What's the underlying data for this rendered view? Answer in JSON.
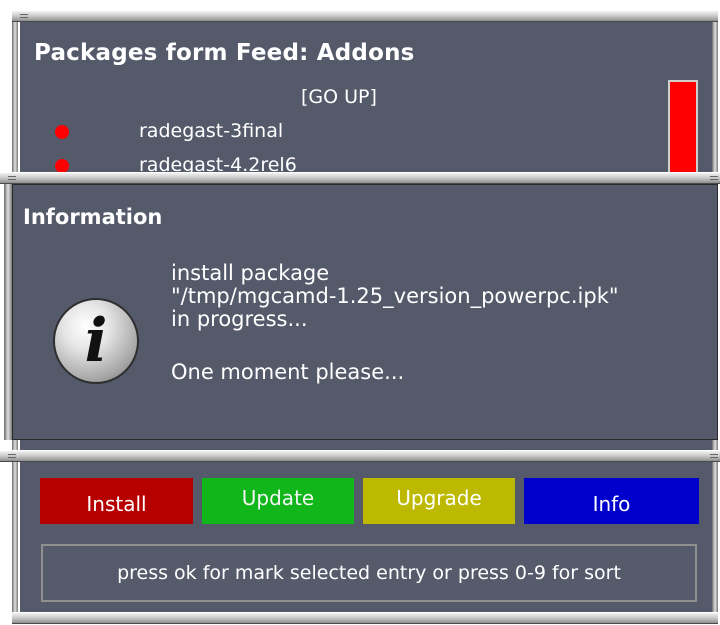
{
  "list_window": {
    "title": "Packages form Feed: Addons",
    "go_up": "[GO UP]",
    "items": [
      {
        "label": "radegast-3final"
      },
      {
        "label": "radegast-4.2rel6"
      }
    ]
  },
  "info_dialog": {
    "title": "Information",
    "icon": "info-icon",
    "icon_glyph": "i",
    "lines": [
      "install package",
      "\"/tmp/mgcamd-1.25_version_powerpc.ipk\"",
      "in progress...",
      "One moment please..."
    ]
  },
  "buttons": {
    "install": "Install",
    "update": "Update",
    "upgrade": "Upgrade",
    "info": "Info"
  },
  "status": "press ok for mark selected entry or press 0-9 for sort",
  "colors": {
    "window_bg": "#555a6b",
    "install": "#b60000",
    "update": "#11b71a",
    "upgrade": "#bdb800",
    "info": "#0000cc",
    "marker": "#ff0000"
  }
}
